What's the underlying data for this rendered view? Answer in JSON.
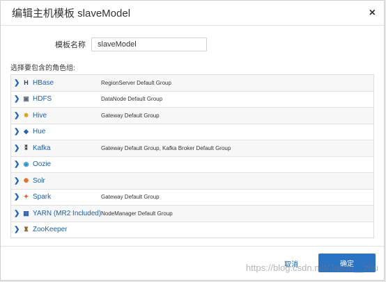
{
  "dialog": {
    "title": "编辑主机模板 slaveModel",
    "close_label": "×",
    "name_label": "模板名称",
    "name_value": "slaveModel",
    "roles_label": "选择要包含的角色组:",
    "cancel_label": "取消",
    "confirm_label": "确定"
  },
  "services": [
    {
      "name": "HBase",
      "groups": "RegionServer Default Group",
      "icon": "hbase-icon",
      "icon_text": "H",
      "icon_color": "#1e3f7a"
    },
    {
      "name": "HDFS",
      "groups": "DataNode Default Group",
      "icon": "hdfs-icon",
      "icon_text": "▣",
      "icon_color": "#5b6b7b"
    },
    {
      "name": "Hive",
      "groups": "Gateway Default Group",
      "icon": "hive-icon",
      "icon_text": "✸",
      "icon_color": "#d9a400"
    },
    {
      "name": "Hue",
      "groups": "",
      "icon": "hue-icon",
      "icon_text": "◆",
      "icon_color": "#2d62b0"
    },
    {
      "name": "Kafka",
      "groups": "Gateway Default Group, Kafka Broker Default Group",
      "icon": "kafka-icon",
      "icon_text": "⁑",
      "icon_color": "#333333"
    },
    {
      "name": "Oozie",
      "groups": "",
      "icon": "oozie-icon",
      "icon_text": "◉",
      "icon_color": "#2f8fc9"
    },
    {
      "name": "Solr",
      "groups": "",
      "icon": "solr-icon",
      "icon_text": "✺",
      "icon_color": "#e0722a"
    },
    {
      "name": "Spark",
      "groups": "Gateway Default Group",
      "icon": "spark-icon",
      "icon_text": "✦",
      "icon_color": "#e25a1c"
    },
    {
      "name": "YARN (MR2 Included)",
      "groups": "NodeManager Default Group",
      "icon": "yarn-icon",
      "icon_text": "▦",
      "icon_color": "#2c5fa6"
    },
    {
      "name": "ZooKeeper",
      "groups": "",
      "icon": "zookeeper-icon",
      "icon_text": "♜",
      "icon_color": "#8a6a2e"
    }
  ],
  "watermark": "https://blog.csdn.net/Jason__zhu"
}
